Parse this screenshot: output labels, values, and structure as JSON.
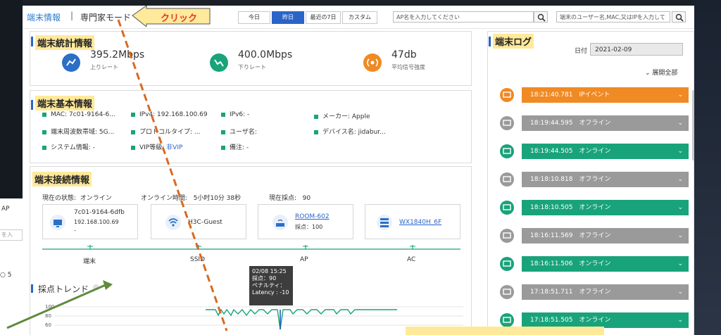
{
  "background_window": {
    "title": "AP",
    "input_placeholder": "を入",
    "radio_label": "5"
  },
  "header": {
    "brand": "端末情報",
    "separator": "|",
    "mode": "専門家モード",
    "callout": "クリック",
    "tabs": [
      "今日",
      "昨日",
      "最近の7日",
      "カスタム"
    ],
    "active_tab": "昨日",
    "ap_search_placeholder": "AP名を入力してください",
    "user_search_placeholder": "端末のユーザー名,MAC,又はIPを入力して"
  },
  "stats": {
    "title": "端末統計情報",
    "items": [
      {
        "value": "395.2Mbps",
        "label": "上りレート",
        "icon": "upload-rate-icon",
        "color": "#2b6fc6"
      },
      {
        "value": "400.0Mbps",
        "label": "下りレート",
        "icon": "download-rate-icon",
        "color": "#19a37b"
      },
      {
        "value": "47db",
        "label": "平均信号強度",
        "icon": "signal-icon",
        "color": "#f08a24"
      }
    ]
  },
  "basic": {
    "title": "端末基本情報",
    "items": [
      "MAC:  7c01-9164-6...",
      "IPv4:  192.168.100.69",
      "IPv6:  -",
      "メーカー:  Apple",
      "端末周波数帯域:  5G...",
      "プロトコルタイプ:  ...",
      "ユーザ名:",
      "デバイス名:  jidabur...",
      "システム情報:  -",
      "VIP等級:",
      "備注:  -"
    ],
    "vip_value": "非VIP"
  },
  "connection": {
    "title": "端末接続情報",
    "status_label": "現在の状態:",
    "status_value": "オンライン",
    "online_label": "オンライン時間:",
    "online_value": "5小时10分 38秒",
    "score_label": "現在採点:",
    "score_value": "90",
    "nodes": {
      "terminal": {
        "line1": "7c01-9164-6dfb",
        "line2": "192.168.100.69",
        "line3": "-"
      },
      "ssid": {
        "name": "H3C-Guest"
      },
      "ap": {
        "name": "ROOM-602",
        "score": "採点：100"
      },
      "ac": {
        "name": "WX1840H_6F"
      }
    },
    "node_labels": [
      "端末",
      "SSID",
      "AP",
      "AC"
    ]
  },
  "trend": {
    "title": "採点トレンド",
    "yticks": [
      "100",
      "80",
      "60"
    ],
    "tooltip": [
      "02/08 15:25",
      "採点：90",
      "ペナルティ：",
      "Latency : -10"
    ]
  },
  "log": {
    "title": "端末ログ",
    "date_label": "日付",
    "date_value": "2021-02-09",
    "expand_label": "展開全部",
    "rows": [
      {
        "time": "18:21:40.781",
        "event": "IPイベント",
        "color": "#f08a24",
        "icon": "ip-event-icon"
      },
      {
        "time": "18:19:44.595",
        "event": "オフライン",
        "color": "#9a9a9a",
        "icon": "offline-icon"
      },
      {
        "time": "18:19:44.505",
        "event": "オンライン",
        "color": "#19a37b",
        "icon": "online-icon"
      },
      {
        "time": "18:18:10.818",
        "event": "オフライン",
        "color": "#9a9a9a",
        "icon": "offline-icon"
      },
      {
        "time": "18:18:10.505",
        "event": "オンライン",
        "color": "#19a37b",
        "icon": "online-icon"
      },
      {
        "time": "18:16:11.569",
        "event": "オフライン",
        "color": "#9a9a9a",
        "icon": "offline-icon"
      },
      {
        "time": "18:16:11.506",
        "event": "オンライン",
        "color": "#19a37b",
        "icon": "online-icon"
      },
      {
        "time": "17:18:51.711",
        "event": "オフライン",
        "color": "#9a9a9a",
        "icon": "offline-icon"
      },
      {
        "time": "17:18:51.505",
        "event": "オンライン",
        "color": "#19a37b",
        "icon": "online-icon"
      }
    ]
  }
}
